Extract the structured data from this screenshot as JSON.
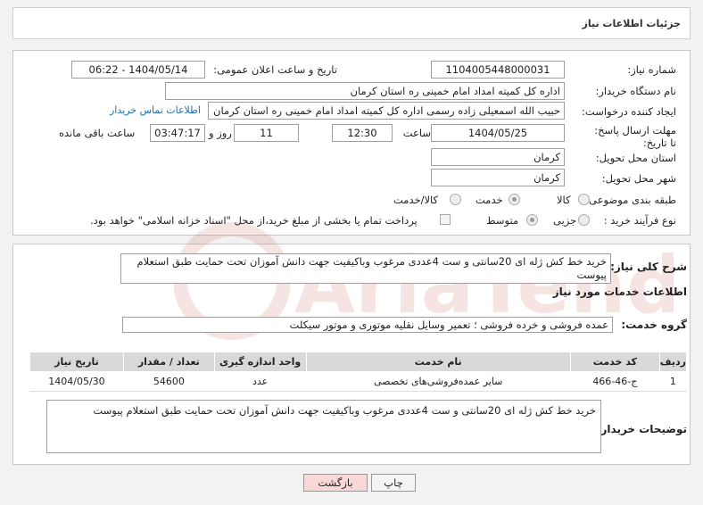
{
  "header": {
    "title": "جزئیات اطلاعات نیاز"
  },
  "fields": {
    "need_number_label": "شماره نیاز:",
    "need_number": "1104005448000031",
    "announce_label": "تاریخ و ساعت اعلان عمومی:",
    "announce_value": "1404/05/14 - 06:22",
    "buyer_org_label": "نام دستگاه خریدار:",
    "buyer_org": "اداره کل کمیته امداد امام خمینی  ره  استان کرمان",
    "creator_label": "ایجاد کننده درخواست:",
    "creator": "حبیب الله اسمعیلی زاده رسمی  اداره کل کمیته امداد امام خمینی  ره  استان کرمان",
    "contact_link": "اطلاعات تماس خریدار",
    "deadline_label": "مهلت ارسال پاسخ: تا تاریخ:",
    "deadline_date": "1404/05/25",
    "time_label": "ساعت",
    "deadline_time": "12:30",
    "days_value": "11",
    "days_label": "روز و",
    "remaining_value": "03:47:17",
    "remaining_label": "ساعت باقی مانده",
    "province_label": "استان محل تحویل:",
    "province": "کرمان",
    "city_label": "شهر محل تحویل:",
    "city": "کرمان",
    "category_label": "طبقه بندی موضوعی:",
    "category_options": [
      "کالا",
      "خدمت",
      "کالا/خدمت"
    ],
    "process_label": "نوع فرآیند خرید :",
    "process_options": [
      "جزیی",
      "متوسط"
    ],
    "payment_note": "پرداخت تمام یا بخشی از مبلغ خرید،از محل \"اسناد خزانه اسلامی\" خواهد بود."
  },
  "summary": {
    "label": "شرح کلی نیاز:",
    "text": "خرید خط کش ژله ای 20سانتی و ست 4عددی مرغوب وباکیفیت جهت دانش آموزان تحت حمایت طبق استعلام پیوست"
  },
  "services": {
    "title": "اطلاعات خدمات مورد نیاز",
    "group_label": "گروه خدمت:",
    "group_value": "عمده فروشی و خرده فروشی ؛ تعمیر وسایل نقلیه موتوری و موتور سیکلت",
    "columns": [
      "ردیف",
      "کد خدمت",
      "نام خدمت",
      "واحد اندازه گیری",
      "تعداد / مقدار",
      "تاریخ نیاز"
    ],
    "rows": [
      [
        "1",
        "ج-46-466",
        "سایر عمده‌فروشی‌های تخصصی",
        "عدد",
        "54600",
        "1404/05/30"
      ]
    ]
  },
  "buyer_notes": {
    "label": "توضیحات خریدار:",
    "text": "خرید خط کش ژله ای 20سانتی و ست 4عددی مرغوب وباکیفیت جهت دانش آموزان تحت حمایت طبق استعلام پیوست"
  },
  "buttons": {
    "print": "چاپ",
    "back": "بازگشت"
  },
  "watermark": {
    "text": "AriaTender.neT"
  },
  "colors": {
    "link": "#1a6fb3",
    "back_button": "#f8d7d7",
    "watermark": "#c0392b"
  }
}
